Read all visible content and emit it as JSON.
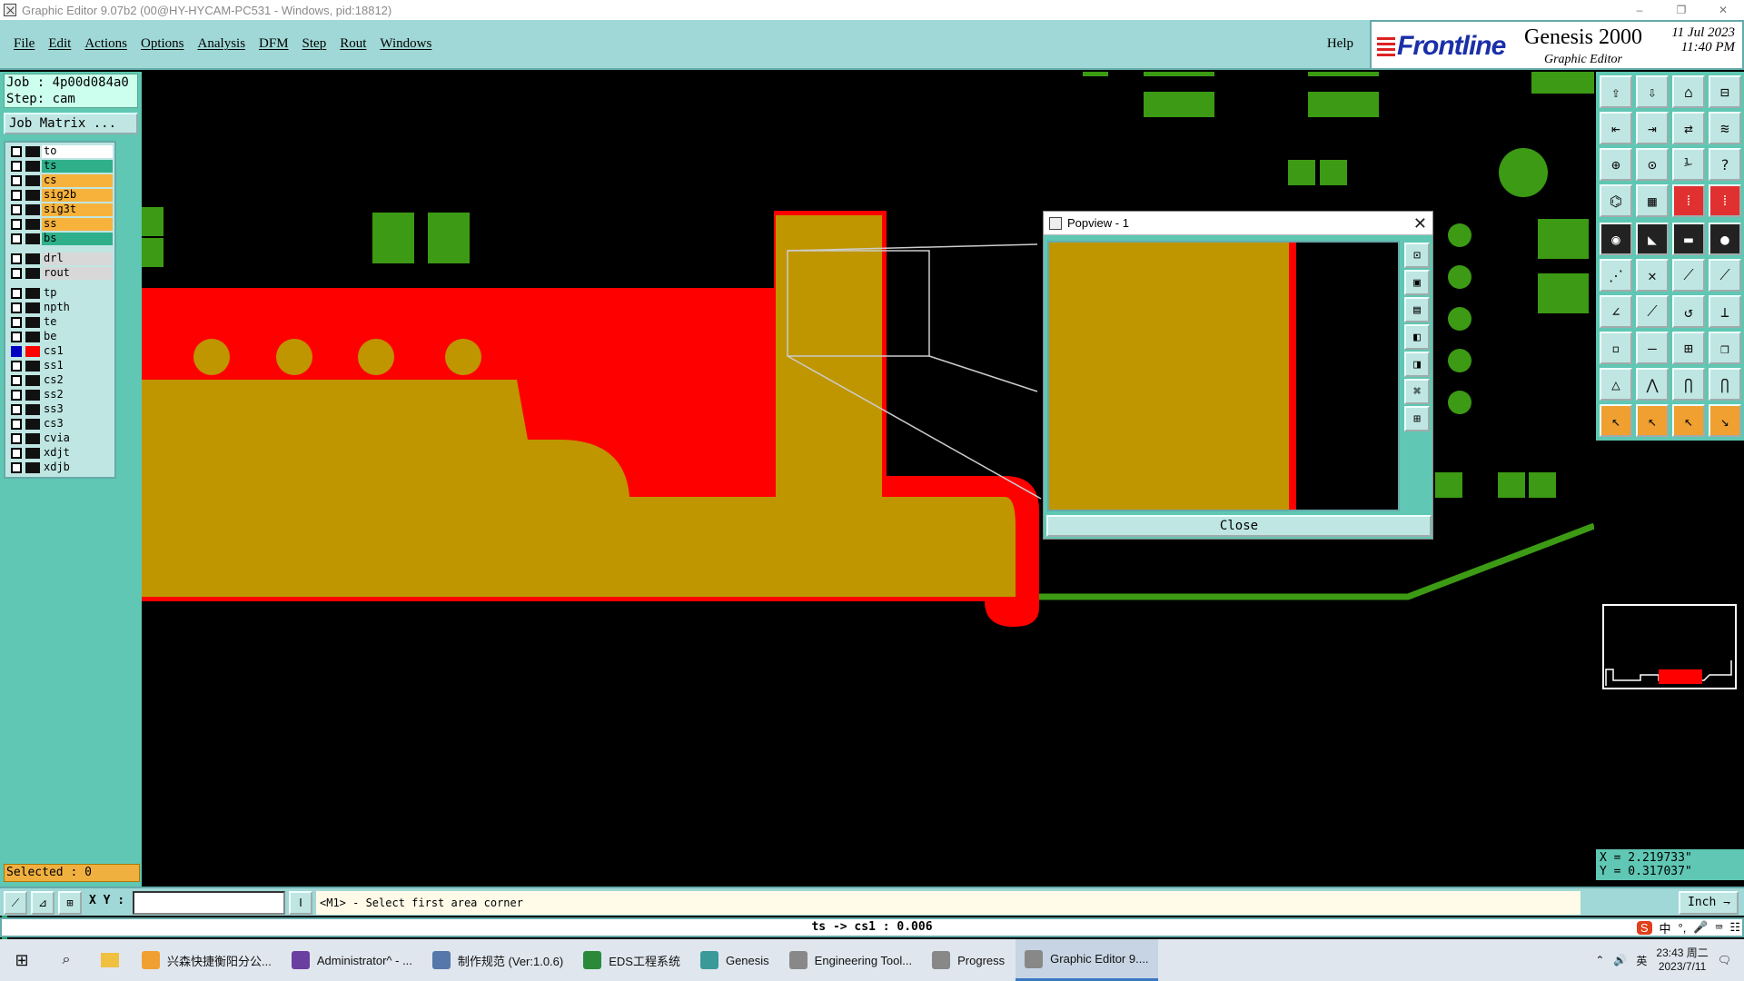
{
  "window": {
    "title": "Graphic Editor 9.07b2 (00@HY-HYCAM-PC531 - Windows, pid:18812)",
    "min": "–",
    "restore": "❐",
    "close": "✕"
  },
  "menu": {
    "items": [
      "File",
      "Edit",
      "Actions",
      "Options",
      "Analysis",
      "DFM",
      "Step",
      "Rout",
      "Windows"
    ],
    "help": "Help"
  },
  "brand": {
    "logo": "Frontline",
    "product": "Genesis 2000",
    "subtitle": "Graphic Editor",
    "date": "11 Jul 2023",
    "time": "11:40 PM"
  },
  "job": {
    "job_line": "Job : 4p00d084a0",
    "step_line": "Step: cam",
    "matrix_button": "Job Matrix ..."
  },
  "layers": [
    {
      "name": "to",
      "color": "#ffffff",
      "swatch": "#111111",
      "active": false,
      "group": 1
    },
    {
      "name": "ts",
      "color": "#2fb08a",
      "swatch": "#111111",
      "active": false,
      "group": 1
    },
    {
      "name": "cs",
      "color": "#f7b23c",
      "swatch": "#111111",
      "active": false,
      "group": 1
    },
    {
      "name": "sig2b",
      "color": "#f7b23c",
      "swatch": "#111111",
      "active": false,
      "group": 1
    },
    {
      "name": "sig3t",
      "color": "#f7b23c",
      "swatch": "#111111",
      "active": false,
      "group": 1
    },
    {
      "name": "ss",
      "color": "#f7b23c",
      "swatch": "#111111",
      "active": false,
      "group": 1
    },
    {
      "name": "bs",
      "color": "#2fb08a",
      "swatch": "#111111",
      "active": false,
      "group": 1
    },
    {
      "name": "drl",
      "color": "#d8d8d8",
      "swatch": "#111111",
      "active": false,
      "group": 2
    },
    {
      "name": "rout",
      "color": "#d8d8d8",
      "swatch": "#111111",
      "active": false,
      "group": 2
    },
    {
      "name": "tp",
      "color": "#bfe6e3",
      "swatch": "#111111",
      "active": false,
      "group": 3
    },
    {
      "name": "npth",
      "color": "#bfe6e3",
      "swatch": "#111111",
      "active": false,
      "group": 3
    },
    {
      "name": "te",
      "color": "#bfe6e3",
      "swatch": "#111111",
      "active": false,
      "group": 3
    },
    {
      "name": "be",
      "color": "#bfe6e3",
      "swatch": "#111111",
      "active": false,
      "group": 3
    },
    {
      "name": "cs1",
      "color": "#bfe6e3",
      "swatch": "#ff0000",
      "active": true,
      "group": 3
    },
    {
      "name": "ss1",
      "color": "#bfe6e3",
      "swatch": "#111111",
      "active": false,
      "group": 3
    },
    {
      "name": "cs2",
      "color": "#bfe6e3",
      "swatch": "#111111",
      "active": false,
      "group": 3
    },
    {
      "name": "ss2",
      "color": "#bfe6e3",
      "swatch": "#111111",
      "active": false,
      "group": 3
    },
    {
      "name": "ss3",
      "color": "#bfe6e3",
      "swatch": "#111111",
      "active": false,
      "group": 3
    },
    {
      "name": "cs3",
      "color": "#bfe6e3",
      "swatch": "#111111",
      "active": false,
      "group": 3
    },
    {
      "name": "cvia",
      "color": "#bfe6e3",
      "swatch": "#111111",
      "active": false,
      "group": 3
    },
    {
      "name": "xdjt",
      "color": "#bfe6e3",
      "swatch": "#111111",
      "active": false,
      "group": 3
    },
    {
      "name": "xdjb",
      "color": "#bfe6e3",
      "swatch": "#111111",
      "active": false,
      "group": 3
    }
  ],
  "selected": "Selected : 0",
  "popview": {
    "title": "Popview - 1",
    "close_x": "✕",
    "close_button": "Close"
  },
  "coords": {
    "x": "X = 2.219733\"",
    "y": "Y = 0.317037\""
  },
  "bottom": {
    "xy_label": "X Y :",
    "xy_value": "",
    "prompt": "<M1> - Select first area corner",
    "unit": "Inch ⇁"
  },
  "status": "ts -> cs1 : 0.006",
  "colors": {
    "copper": "#bf9600",
    "red": "#ff0000",
    "green": "#3c9a14",
    "panel": "#5fc7b3",
    "menu": "#9fd8d6"
  },
  "taskbar": {
    "items": [
      {
        "label": "兴森快捷衡阳分公...",
        "icon": "#f0a030",
        "active": false
      },
      {
        "label": "Administrator^ - ...",
        "icon": "#6b3fa0",
        "active": false
      },
      {
        "label": "制作规范 (Ver:1.0.6)",
        "icon": "#5577aa",
        "active": false
      },
      {
        "label": "EDS工程系统",
        "icon": "#2a8a3a",
        "active": false
      },
      {
        "label": "Genesis",
        "icon": "#3a9a9a",
        "active": false
      },
      {
        "label": "Engineering Tool...",
        "icon": "#888888",
        "active": false
      },
      {
        "label": "Progress",
        "icon": "#888888",
        "active": false
      },
      {
        "label": "Graphic Editor 9....",
        "icon": "#888888",
        "active": true
      }
    ],
    "tray_lang": "英",
    "clock_time": "23:43 周二",
    "clock_date": "2023/7/11"
  },
  "ime": {
    "lang1": "中",
    "punct": "°,"
  }
}
